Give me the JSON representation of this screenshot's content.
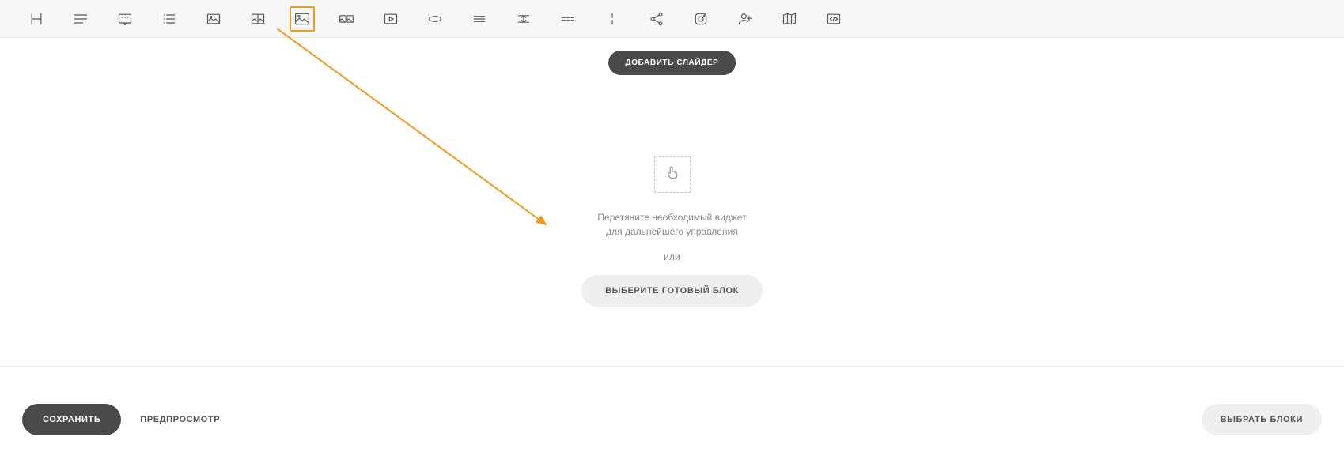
{
  "toolbar": {
    "items": [
      {
        "name": "heading-icon"
      },
      {
        "name": "text-icon"
      },
      {
        "name": "quote-icon"
      },
      {
        "name": "list-icon"
      },
      {
        "name": "image-icon"
      },
      {
        "name": "image-collage-icon"
      },
      {
        "name": "image-big-icon"
      },
      {
        "name": "gallery-icon"
      },
      {
        "name": "video-icon"
      },
      {
        "name": "link-icon"
      },
      {
        "name": "divider-icon"
      },
      {
        "name": "spacer-icon"
      },
      {
        "name": "dashes-icon"
      },
      {
        "name": "vertical-line-icon"
      },
      {
        "name": "share-icon"
      },
      {
        "name": "instagram-icon"
      },
      {
        "name": "add-user-icon"
      },
      {
        "name": "map-icon"
      },
      {
        "name": "code-icon"
      }
    ],
    "selected_index": 6
  },
  "buttons": {
    "add_slider": "ДОБАВИТЬ СЛАЙДЕР",
    "choose_block": "ВЫБЕРИТЕ ГОТОВЫЙ БЛОК",
    "save": "СОХРАНИТЬ",
    "preview": "ПРЕДПРОСМОТР",
    "choose_blocks": "ВЫБРАТЬ БЛОКИ"
  },
  "drop": {
    "line1": "Перетяните необходимый виджет",
    "line2": "для дальнейшего управления",
    "or": "или"
  }
}
